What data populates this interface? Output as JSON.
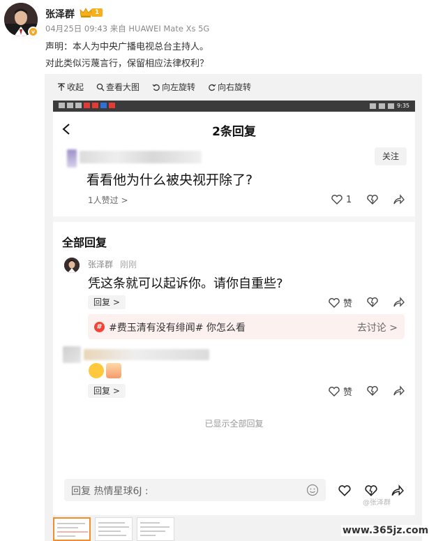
{
  "post": {
    "author": "张泽群",
    "vip_level": "1",
    "meta": "04月25日 09:43  来自 HUAWEI Mate Xs 5G",
    "line1": "声明：本人为中央广播电视总台主持人。",
    "line2": "对此类似污蔑言行，保留相应法律权利？"
  },
  "viewer_toolbar": {
    "collapse": "收起",
    "view_large": "查看大图",
    "rotate_left": "向左旋转",
    "rotate_right": "向右旋转"
  },
  "phone": {
    "status_time": "9:35",
    "title": "2条回复",
    "follow": "关注",
    "main_comment": "看看他为什么被央视开除了?",
    "likes_link": "1人赞过 >",
    "like_count": "1",
    "all_replies": "全部回复",
    "reply1": {
      "name": "张泽群",
      "time": "刚刚",
      "text": "凭这条就可以起诉你。请你自重些?",
      "reply_btn": "回复 >",
      "like_label": "赞"
    },
    "topic": {
      "text": "#费玉清有没有绯闻# 你怎么看",
      "link": "去讨论 >"
    },
    "reply2": {
      "reply_btn": "回复 >",
      "like_label": "赞"
    },
    "shown_all": "已显示全部回复",
    "input_label": "回复 热情星球6J :",
    "watermark": "@张泽群"
  },
  "site_watermark": "www.365jz.com",
  "colors": {
    "vip": "#f6b01c",
    "topic_bg": "#fdf1f0",
    "thumb_active": "#f78c2a"
  }
}
